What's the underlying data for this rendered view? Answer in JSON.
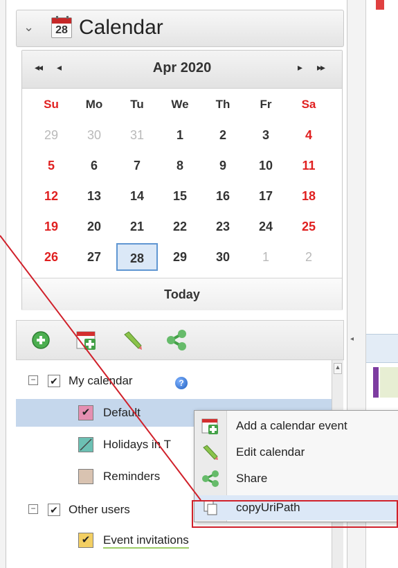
{
  "panel": {
    "title": "Calendar",
    "icon_day": "28"
  },
  "calendar": {
    "nav": {
      "first": "◂◂",
      "prev": "◂",
      "next": "▸",
      "last": "▸▸"
    },
    "month_label": "Apr 2020",
    "weekdays": [
      "Su",
      "Mo",
      "Tu",
      "We",
      "Th",
      "Fr",
      "Sa"
    ],
    "weeks": [
      [
        "29",
        "30",
        "31",
        "1",
        "2",
        "3",
        "4"
      ],
      [
        "5",
        "6",
        "7",
        "8",
        "9",
        "10",
        "11"
      ],
      [
        "12",
        "13",
        "14",
        "15",
        "16",
        "17",
        "18"
      ],
      [
        "19",
        "20",
        "21",
        "22",
        "23",
        "24",
        "25"
      ],
      [
        "26",
        "27",
        "28",
        "29",
        "30",
        "1",
        "2"
      ]
    ],
    "selected_day": "28",
    "today_label": "Today"
  },
  "toolbar": {
    "icons": [
      "add-circle-icon",
      "add-calendar-icon",
      "edit-pencil-icon",
      "share-icon"
    ]
  },
  "tree": {
    "my_calendar": "My calendar",
    "help_icon_glyph": "?",
    "default": "Default",
    "holidays": "Holidays in T",
    "reminders": "Reminders",
    "other_users": "Other users",
    "event_invitations": "Event invitations"
  },
  "context_menu": {
    "items": [
      {
        "label": "Add a calendar event",
        "icon": "add-calendar-icon"
      },
      {
        "label": "Edit calendar",
        "icon": "edit-pencil-icon"
      },
      {
        "label": "Share",
        "icon": "share-icon"
      },
      {
        "label": "copyUriPath",
        "icon": "copy-icon"
      }
    ]
  },
  "colors": {
    "weekend_red": "#e02020",
    "selection_blue": "#5f96d2",
    "highlight_red": "#d0202a",
    "default_swatch": "#e58fb1",
    "holidays_swatch": "#6cc0b3",
    "reminders_swatch": "#d9c3b1",
    "invitations_swatch": "#f3cf63"
  }
}
